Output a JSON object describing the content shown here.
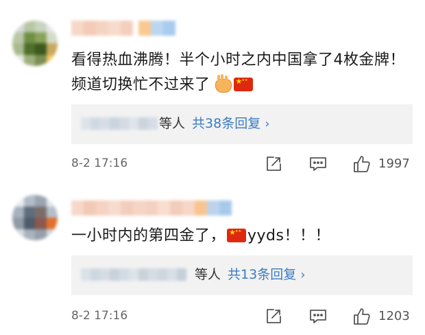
{
  "colors": {
    "link_blue": "#3a7bc4",
    "reply_bg": "#f2f2f2",
    "meta_gray": "#666666"
  },
  "comments": [
    {
      "author_label": "blurred-username",
      "text_before_emoji": "看得热血沸腾！半个小时之内中国拿了4枚金牌！频道切换忙不过来了",
      "emojis": [
        "victory-hands-emoji",
        "china-flag-emoji"
      ],
      "replies": {
        "suffix": "等人",
        "count_label": "共38条回复",
        "arrow": "›"
      },
      "time": "8-2 17:16",
      "likes": "1997"
    },
    {
      "author_label": "blurred-username",
      "text_before_emoji": "一小时内的第四金了，",
      "emojis": [
        "china-flag-emoji"
      ],
      "text_after_emoji": "yyds！！！",
      "replies": {
        "suffix": "等人",
        "count_label": "共13条回复",
        "arrow": "›"
      },
      "time": "8-2 17:16",
      "likes": "1203"
    }
  ],
  "icons": {
    "share": "share-icon",
    "comment": "comment-icon",
    "like": "thumbs-up-icon"
  }
}
